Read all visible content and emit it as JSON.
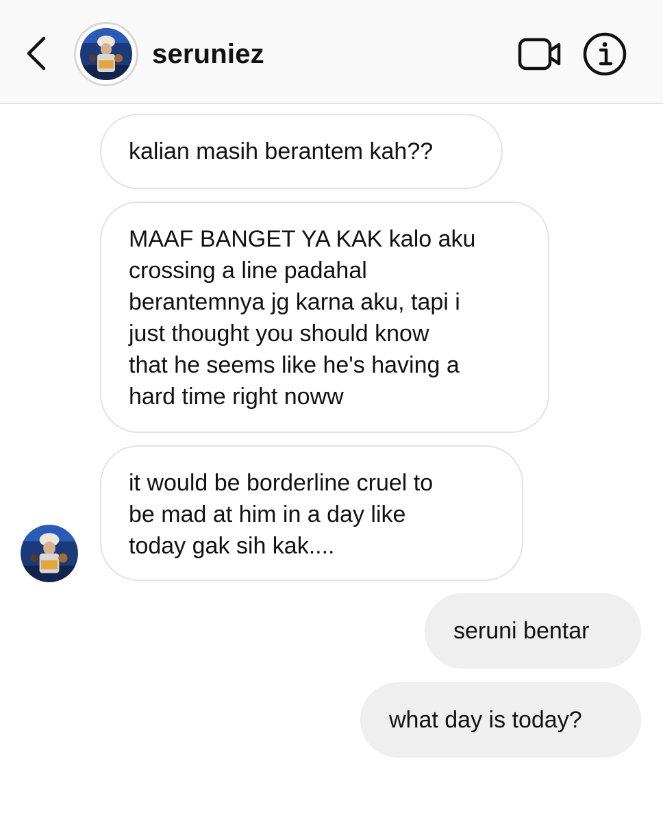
{
  "header": {
    "username": "seruniez",
    "back_icon": "chevron-left-icon",
    "video_icon": "video-camera-icon",
    "info_icon": "info-icon"
  },
  "messages": [
    {
      "direction": "incoming",
      "lines": [
        "kalian masih berantem kah??"
      ]
    },
    {
      "direction": "incoming",
      "lines": [
        "MAAF BANGET YA KAK kalo aku",
        "crossing a line padahal",
        "berantemnya jg karna aku, tapi i",
        "just thought you should know",
        "that he seems like he's having a",
        "hard time right noww"
      ]
    },
    {
      "direction": "incoming",
      "lines": [
        "it would be borderline cruel to",
        "be mad at him in a day like",
        "today gak sih kak...."
      ]
    },
    {
      "direction": "outgoing",
      "lines": [
        "seruni bentar"
      ]
    },
    {
      "direction": "outgoing",
      "lines": [
        "what day is today?"
      ]
    }
  ],
  "colors": {
    "header_bg": "#f9f9f9",
    "incoming_bubble_border": "#e3e3e3",
    "outgoing_bubble_bg": "#efefef",
    "text": "#111111"
  }
}
